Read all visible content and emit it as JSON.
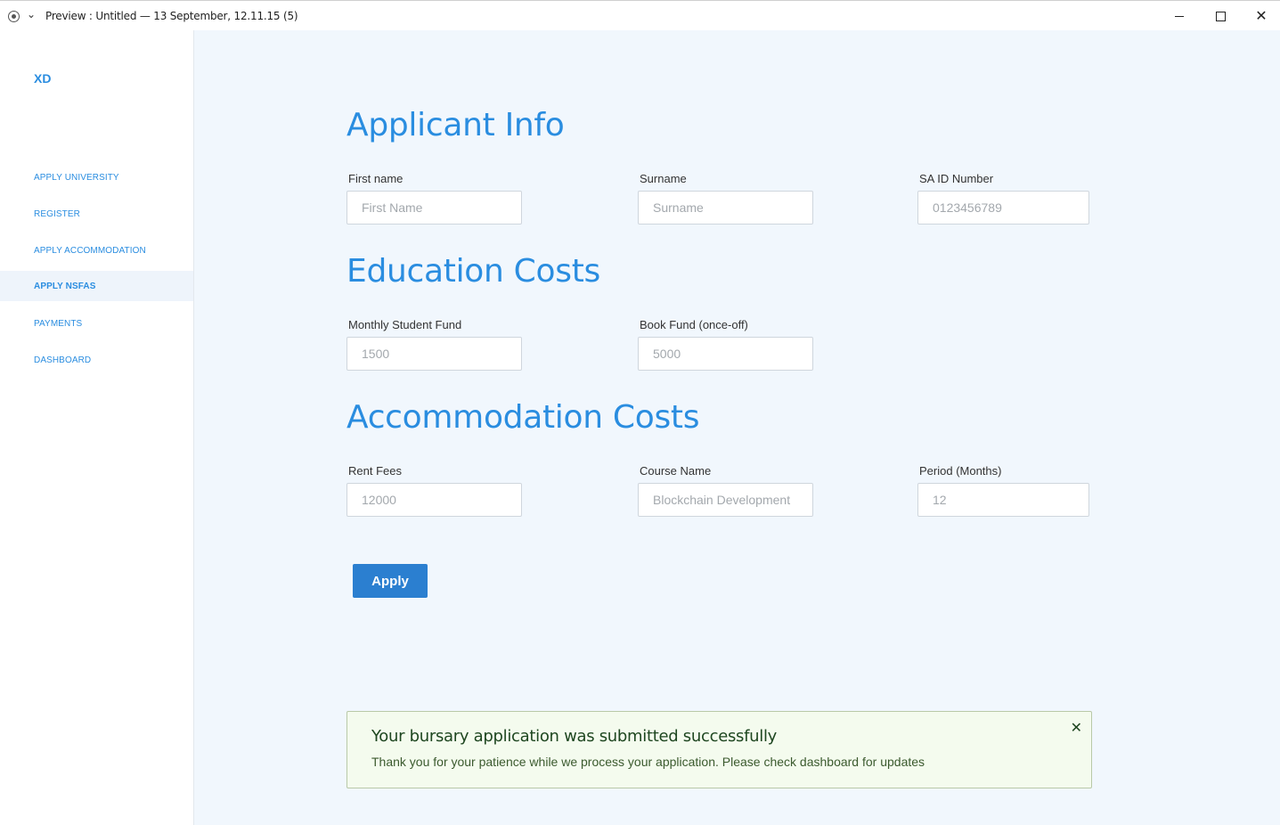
{
  "window": {
    "title": "Preview : Untitled — 13 September, 12.11.15 (5)",
    "chevron": "⌄",
    "close_glyph": "✕"
  },
  "sidebar": {
    "logo": "XD",
    "items": [
      {
        "label": "APPLY UNIVERSITY",
        "active": false
      },
      {
        "label": "REGISTER",
        "active": false
      },
      {
        "label": "APPLY ACCOMMODATION",
        "active": false
      },
      {
        "label": "APPLY NSFAS",
        "active": true
      },
      {
        "label": "PAYMENTS",
        "active": false
      },
      {
        "label": "DASHBOARD",
        "active": false
      }
    ]
  },
  "form": {
    "applicant_info": {
      "title": "Applicant Info",
      "first_name": {
        "label": "First name",
        "placeholder": "First Name",
        "value": ""
      },
      "surname": {
        "label": "Surname",
        "placeholder": "Surname",
        "value": ""
      },
      "id_number": {
        "label": "SA ID Number",
        "placeholder": "0123456789",
        "value": ""
      }
    },
    "education_costs": {
      "title": "Education Costs",
      "monthly_fund": {
        "label": "Monthly Student Fund",
        "placeholder": "1500",
        "value": ""
      },
      "book_fund": {
        "label": "Book Fund (once-off)",
        "placeholder": "5000",
        "value": ""
      }
    },
    "accommodation_costs": {
      "title": "Accommodation Costs",
      "rent_fees": {
        "label": "Rent Fees",
        "placeholder": "12000",
        "value": ""
      },
      "course_name": {
        "label": "Course Name",
        "placeholder": "Blockchain Development",
        "value": ""
      },
      "period": {
        "label": "Period (Months)",
        "placeholder": "12",
        "value": ""
      }
    },
    "submit_label": "Apply"
  },
  "alert": {
    "title": "Your bursary application was submitted successfully",
    "body": "Thank you for your patience while we process your application. Please check dashboard for updates",
    "close_glyph": "✕"
  },
  "colors": {
    "accent": "#2a8de0",
    "button": "#2b7fd0",
    "main_bg": "#f1f7fd",
    "alert_bg": "#f4fbee",
    "alert_text": "#1e4620"
  }
}
